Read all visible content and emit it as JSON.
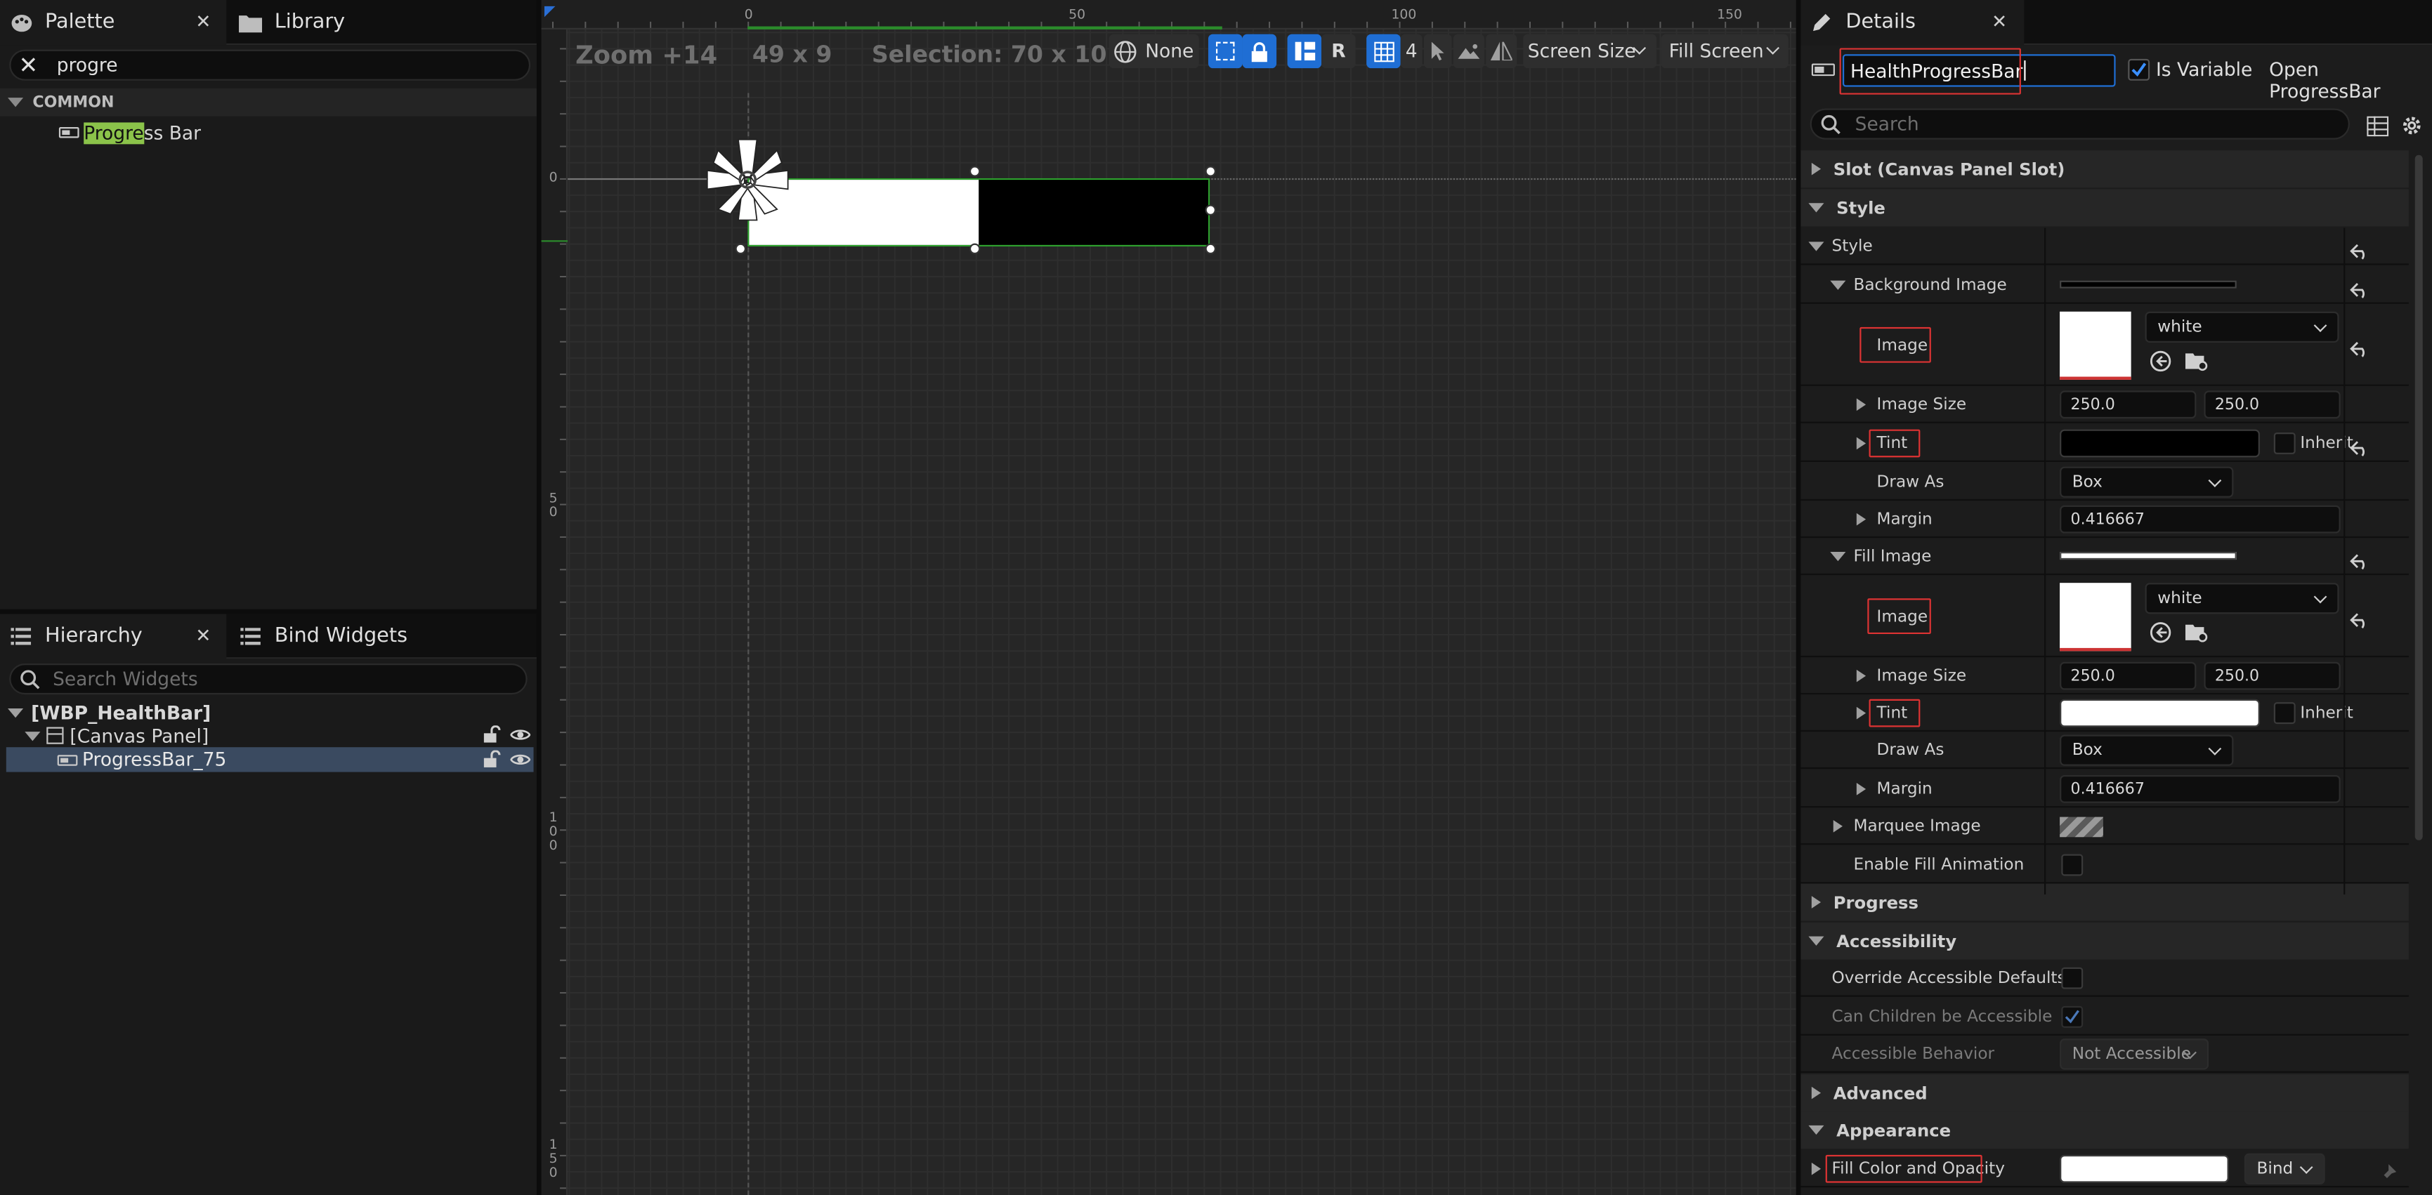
{
  "palette": {
    "tab_label": "Palette",
    "library_tab_label": "Library",
    "search_value": "progre",
    "category": "COMMON",
    "item_highlight": "Progre",
    "item_rest": "ss Bar"
  },
  "hierarchy": {
    "tab_label": "Hierarchy",
    "bind_tab_label": "Bind Widgets",
    "search_placeholder": "Search Widgets",
    "root": "[WBP_HealthBar]",
    "canvas": "[Canvas Panel]",
    "widget": "ProgressBar_75"
  },
  "viewport": {
    "zoom": "Zoom +14",
    "dims": "49 x 9",
    "selection": "Selection: 70 x 10",
    "localization": "None",
    "r_label": "R",
    "grid_snap": "4",
    "screen_size": "Screen Size",
    "fill_screen": "Fill Screen",
    "ruler_top": [
      "0",
      "50",
      "100",
      "150"
    ],
    "ruler_left": [
      "0",
      "5\n0",
      "1\n0\n0",
      "1\n5\n0"
    ],
    "progress_percent": 50
  },
  "details": {
    "tab_label": "Details",
    "name_value": "HealthProgressBar",
    "is_variable_label": "Is Variable",
    "open_label": "Open ProgressBar",
    "search_placeholder": "Search",
    "slot_label": "Slot (Canvas Panel Slot)",
    "style_category": "Style",
    "style_label": "Style",
    "background_image": "Background Image",
    "image_label": "Image",
    "image_name": "white",
    "image_size_label": "Image Size",
    "image_size_x": "250.0",
    "image_size_y": "250.0",
    "tint_label": "Tint",
    "inherit_label": "Inherit",
    "draw_as_label": "Draw As",
    "draw_as_value": "Box",
    "margin_label": "Margin",
    "margin_value": "0.416667",
    "fill_image": "Fill Image",
    "marquee_image": "Marquee Image",
    "enable_fill_animation": "Enable Fill Animation",
    "progress_category": "Progress",
    "accessibility_category": "Accessibility",
    "override_accessible": "Override Accessible Defaults",
    "can_children": "Can Children be Accessible",
    "accessible_behavior": "Accessible Behavior",
    "accessible_behavior_value": "Not Accessible",
    "advanced_category": "Advanced",
    "appearance_category": "Appearance",
    "fill_color_label": "Fill Color and Opacity",
    "bind_label": "Bind"
  },
  "colors": {
    "accent": "#1f6ed4",
    "selection": "#3a4a60",
    "highlight": "#8bc34a",
    "red_marker": "#d33333"
  }
}
